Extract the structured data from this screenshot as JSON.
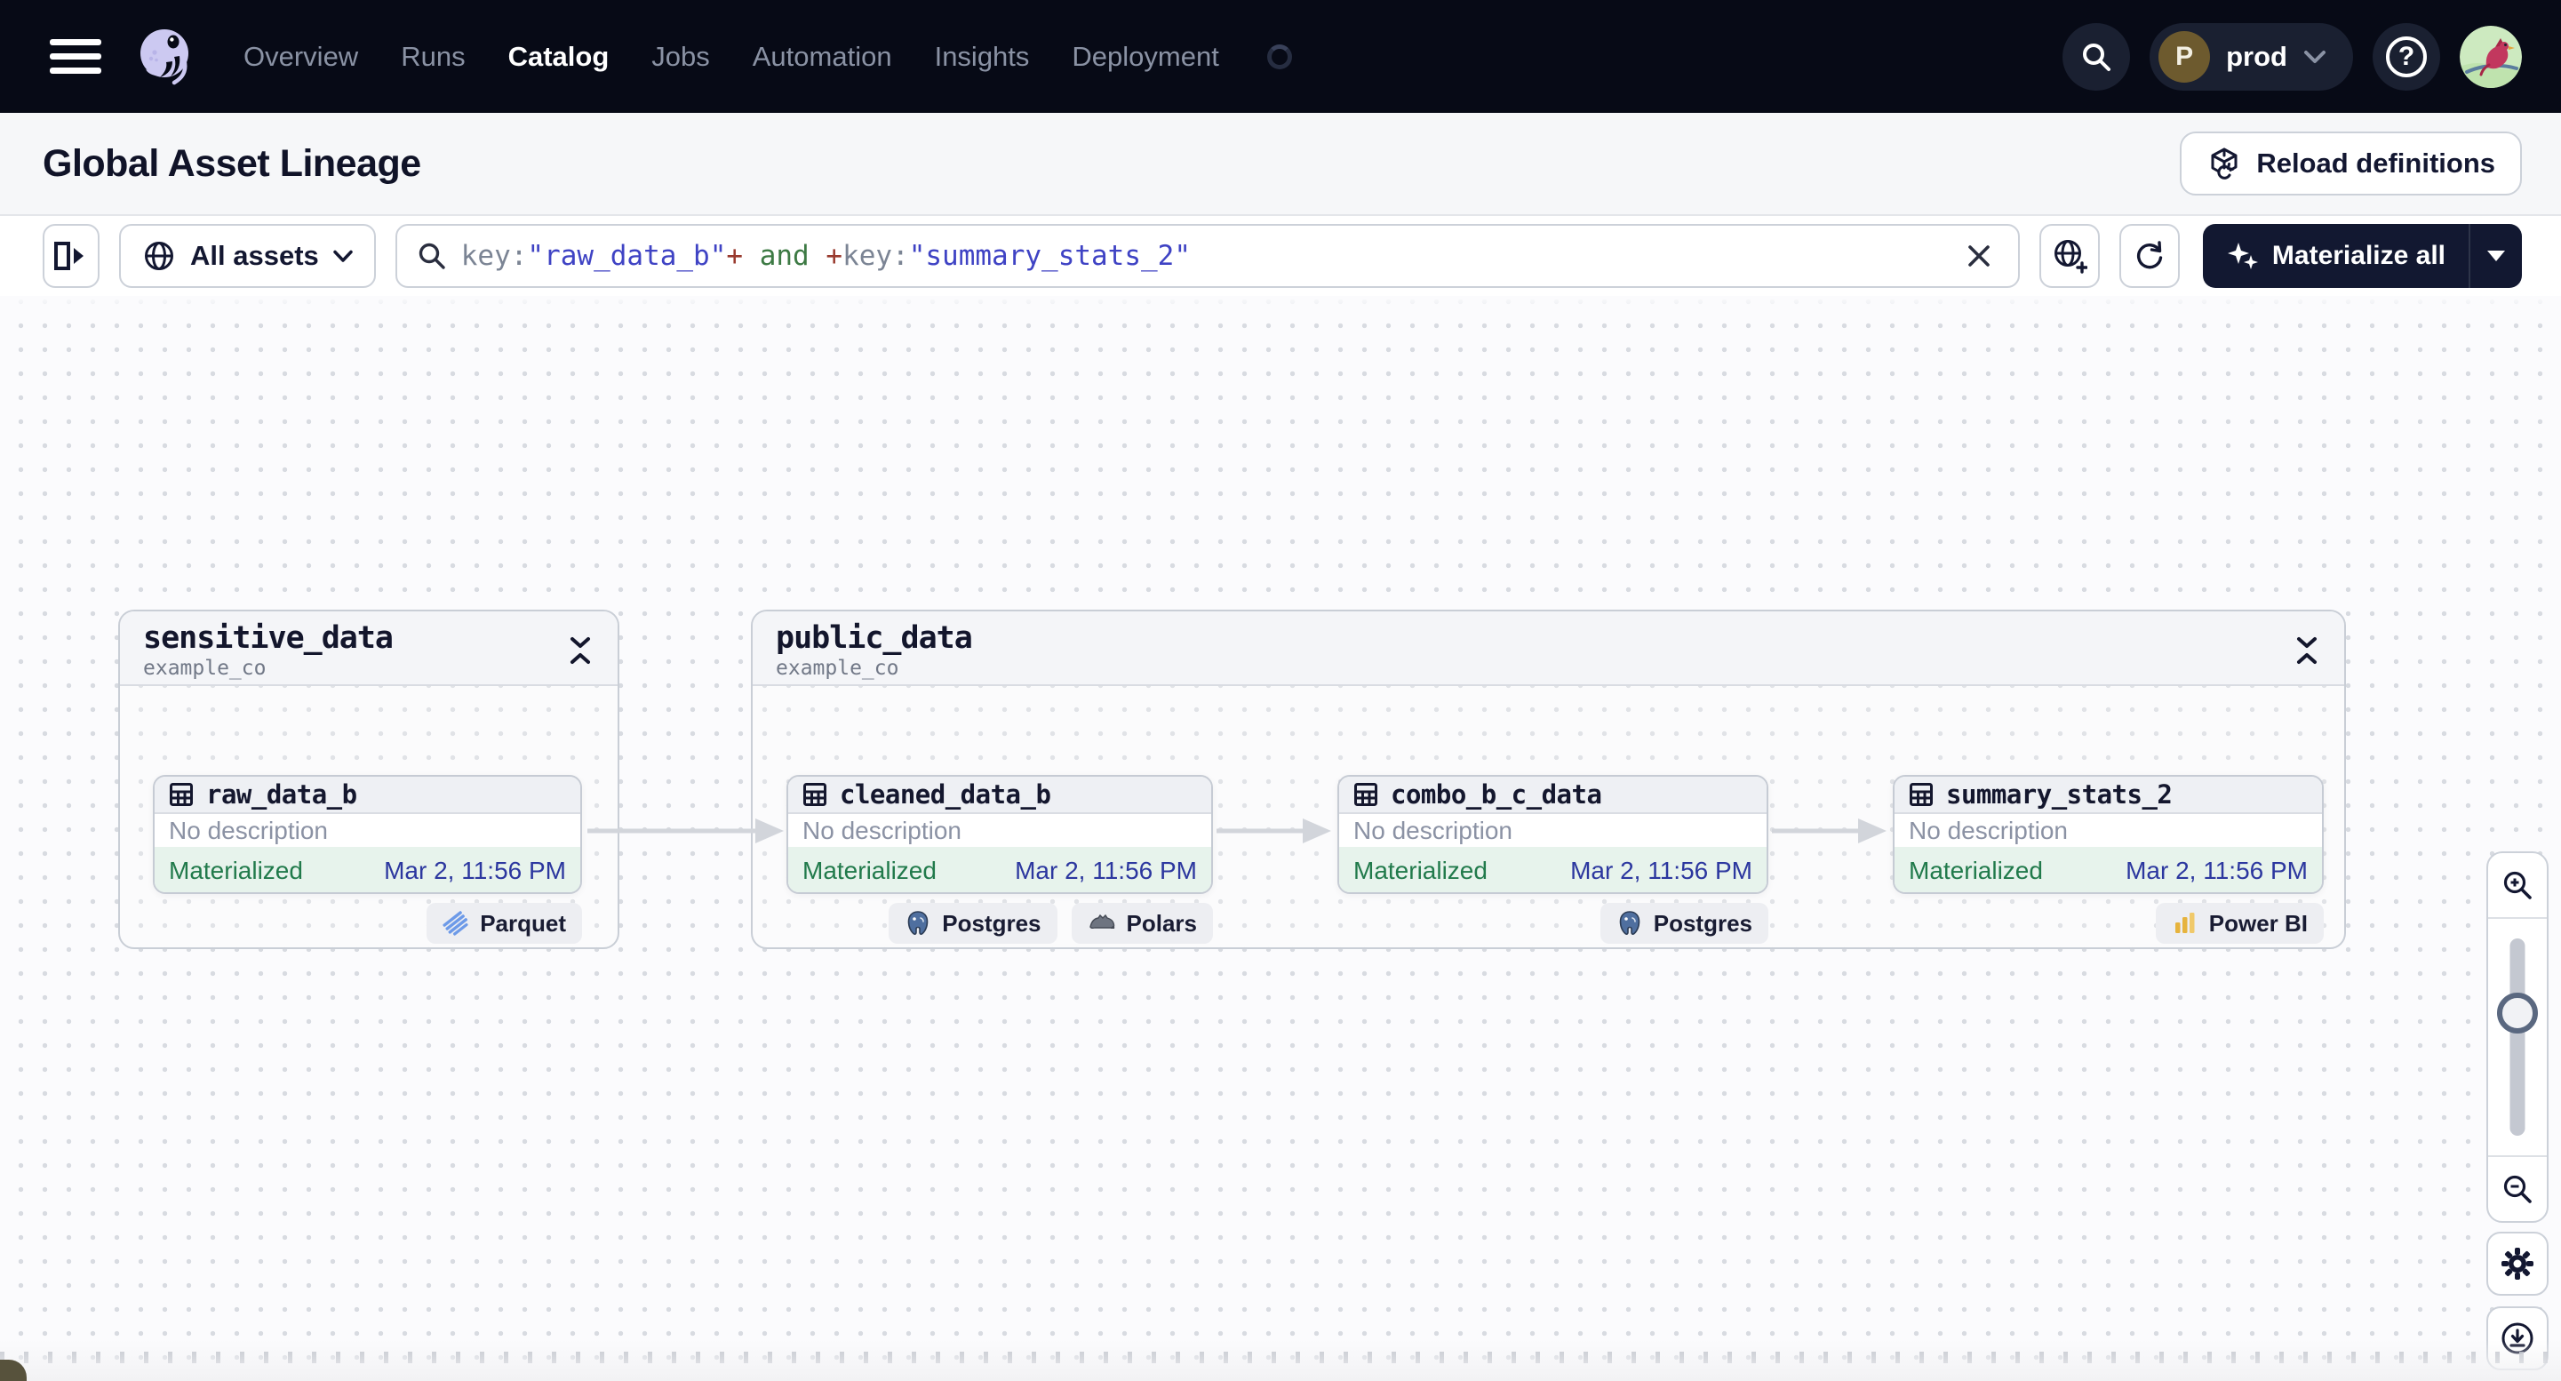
{
  "colors": {
    "nav_bg": "#070a16",
    "nav_active_text": "#ffffff",
    "nav_inactive_text": "#8a92a4",
    "status_materialized_text": "#217a4b",
    "status_materialized_bg": "#e7f3ec",
    "timestamp_text": "#2c379f",
    "query_attribute": "#7b8494",
    "query_string": "#3f43c4",
    "query_operator": "#993a2e",
    "query_keyword": "#3d7a44",
    "materialize_button_bg": "#121831",
    "parquet_icon_blue": "#6d9ae8",
    "powerbi_icon_yellow": "#e6b33d"
  },
  "nav": {
    "items": [
      {
        "label": "Overview"
      },
      {
        "label": "Runs"
      },
      {
        "label": "Catalog"
      },
      {
        "label": "Jobs"
      },
      {
        "label": "Automation"
      },
      {
        "label": "Insights"
      },
      {
        "label": "Deployment"
      }
    ],
    "active_item": "Catalog",
    "deployment": {
      "initial": "P",
      "label": "prod"
    }
  },
  "header": {
    "title": "Global Asset Lineage",
    "reload_label": "Reload definitions"
  },
  "toolbar": {
    "scope_label": "All assets",
    "materialize_label": "Materialize all",
    "query": {
      "segments": [
        {
          "text": "key:",
          "type": "attribute"
        },
        {
          "text": "\"raw_data_b\"",
          "type": "string"
        },
        {
          "text": "+",
          "type": "operator"
        },
        {
          "text": " and ",
          "type": "keyword"
        },
        {
          "text": "+",
          "type": "operator"
        },
        {
          "text": "key:",
          "type": "attribute"
        },
        {
          "text": "\"summary_stats_2\"",
          "type": "string"
        }
      ]
    }
  },
  "graph": {
    "groups": [
      {
        "name": "sensitive_data",
        "repo": "example_co"
      },
      {
        "name": "public_data",
        "repo": "example_co"
      }
    ],
    "nodes": [
      {
        "name": "raw_data_b",
        "description": "No description",
        "status": "Materialized",
        "timestamp": "Mar 2, 11:56 PM",
        "tags": [
          {
            "label": "Parquet",
            "icon": "parquet-icon"
          }
        ]
      },
      {
        "name": "cleaned_data_b",
        "description": "No description",
        "status": "Materialized",
        "timestamp": "Mar 2, 11:56 PM",
        "tags": [
          {
            "label": "Postgres",
            "icon": "postgres-icon"
          },
          {
            "label": "Polars",
            "icon": "polars-icon"
          }
        ]
      },
      {
        "name": "combo_b_c_data",
        "description": "No description",
        "status": "Materialized",
        "timestamp": "Mar 2, 11:56 PM",
        "tags": [
          {
            "label": "Postgres",
            "icon": "postgres-icon"
          }
        ]
      },
      {
        "name": "summary_stats_2",
        "description": "No description",
        "status": "Materialized",
        "timestamp": "Mar 2, 11:56 PM",
        "tags": [
          {
            "label": "Power BI",
            "icon": "powerbi-icon"
          }
        ]
      }
    ]
  }
}
